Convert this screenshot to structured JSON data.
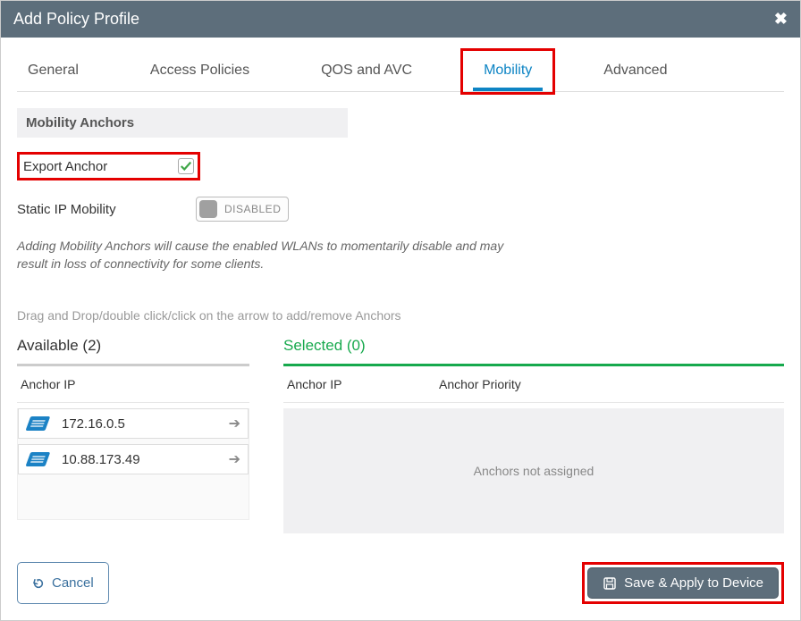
{
  "header": {
    "title": "Add Policy Profile"
  },
  "tabs": {
    "general": "General",
    "accessPolicies": "Access Policies",
    "qosAvc": "QOS and AVC",
    "mobility": "Mobility",
    "advanced": "Advanced"
  },
  "sections": {
    "mobilityAnchors": "Mobility Anchors"
  },
  "fields": {
    "exportAnchorLabel": "Export Anchor",
    "staticIpMobilityLabel": "Static IP Mobility",
    "toggleDisabled": "DISABLED"
  },
  "helpText": "Adding Mobility Anchors will cause the enabled WLANs to momentarily disable and may result in loss of connectivity for some clients.",
  "instructionText": "Drag and Drop/double click/click on the arrow to add/remove Anchors",
  "availableTitle": "Available (2)",
  "selectedTitle": "Selected (0)",
  "headers": {
    "anchorIp": "Anchor IP",
    "anchorPriority": "Anchor Priority"
  },
  "availableAnchors": {
    "0": {
      "ip": "172.16.0.5"
    },
    "1": {
      "ip": "10.88.173.49"
    }
  },
  "emptySelectedText": "Anchors not assigned",
  "buttons": {
    "cancel": "Cancel",
    "save": "Save & Apply to Device"
  }
}
